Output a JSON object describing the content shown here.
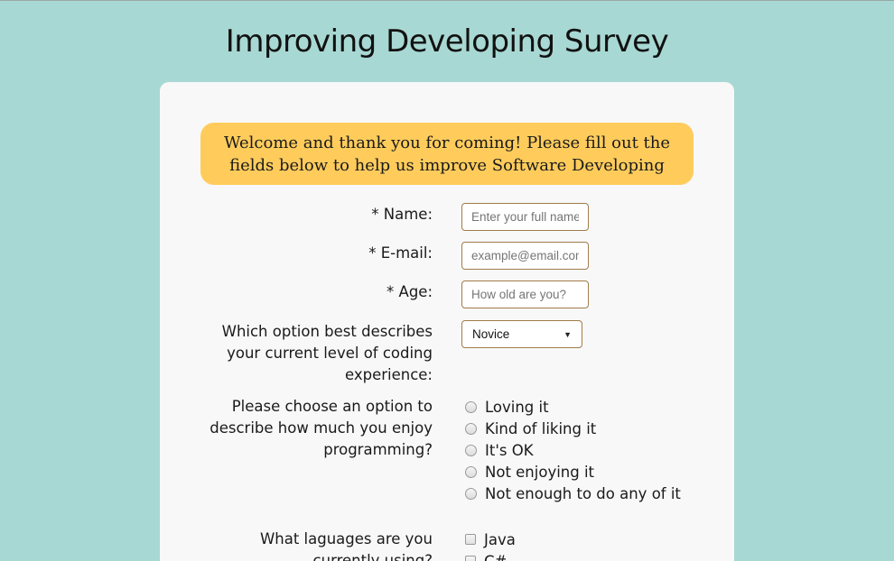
{
  "page": {
    "title": "Improving Developing Survey",
    "welcome": "Welcome and thank you for coming! Please fill out the fields below to help us improve Software Developing"
  },
  "form": {
    "name": {
      "label": "* Name:",
      "placeholder": "Enter your full name"
    },
    "email": {
      "label": "* E-mail:",
      "placeholder": "example@email.com"
    },
    "age": {
      "label": "* Age:",
      "placeholder": "How old are you?"
    },
    "experience": {
      "label": "Which option best describes your current level of coding experience:",
      "selected": "Novice"
    },
    "enjoyment": {
      "label": "Please choose an option to describe how much you enjoy programming?",
      "options": [
        "Loving it",
        "Kind of liking it",
        "It's OK",
        "Not enjoying it",
        "Not enough to do any of it"
      ]
    },
    "languages": {
      "label": "What laguages are you currently using?",
      "options": [
        "Java",
        "C#"
      ]
    }
  },
  "colors": {
    "background": "#a8d8d3",
    "card": "#f8f8f8",
    "welcome_banner": "#ffcc5c",
    "input_border": "#a07c4a"
  }
}
